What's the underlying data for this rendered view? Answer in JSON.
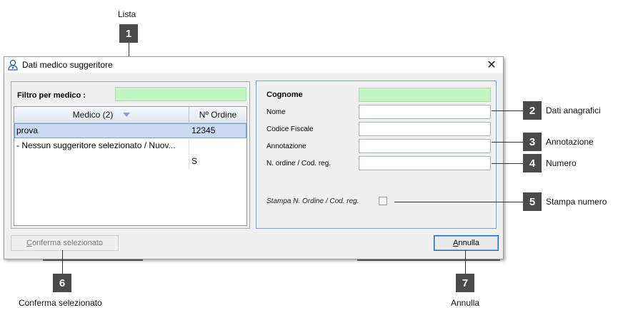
{
  "annotations": {
    "callouts": [
      {
        "number": "1",
        "label": "Lista"
      },
      {
        "number": "2",
        "label": "Dati anagrafici"
      },
      {
        "number": "3",
        "label": "Annotazione"
      },
      {
        "number": "4",
        "label": "Numero"
      },
      {
        "number": "5",
        "label": "Stampa numero"
      },
      {
        "number": "6",
        "label": "Conferma selezionato"
      },
      {
        "number": "7",
        "label": "Annulla"
      }
    ]
  },
  "window": {
    "title": "Dati medico suggeritore",
    "icon": "doctor-icon",
    "close_glyph": "✕"
  },
  "filter": {
    "label": "Filtro per medico :",
    "value": ""
  },
  "grid": {
    "columns": [
      "Medico (2)",
      "Nº Ordine"
    ],
    "sort_icon": "sort-descending-icon",
    "rows": [
      {
        "medico": "prova",
        "ordine": "12345",
        "selected": true
      },
      {
        "medico": "- Nessun suggeritore selezionato / Nuov...",
        "ordine": "",
        "selected": false
      },
      {
        "medico": "",
        "ordine": "S",
        "selected": false
      }
    ]
  },
  "form": {
    "cognome": {
      "label": "Cognome",
      "value": ""
    },
    "nome": {
      "label": "Nome",
      "value": ""
    },
    "codice_fiscale": {
      "label": "Codice Fiscale",
      "value": ""
    },
    "annotazione": {
      "label": "Annotazione",
      "value": ""
    },
    "ordine": {
      "label": "N. ordine / Cod. reg.",
      "value": ""
    },
    "stampa": {
      "label": "Stampa N. Ordine / Cod. reg.",
      "checked": false
    }
  },
  "buttons": {
    "conferma": {
      "prefix": "C",
      "rest": "onferma selezionato",
      "enabled": false
    },
    "annulla": {
      "prefix": "A",
      "rest": "nnulla",
      "enabled": true
    }
  },
  "colors": {
    "required_field": "#c2f6c2",
    "selection": "#c8daf2",
    "callout": "#4a4a4a"
  }
}
